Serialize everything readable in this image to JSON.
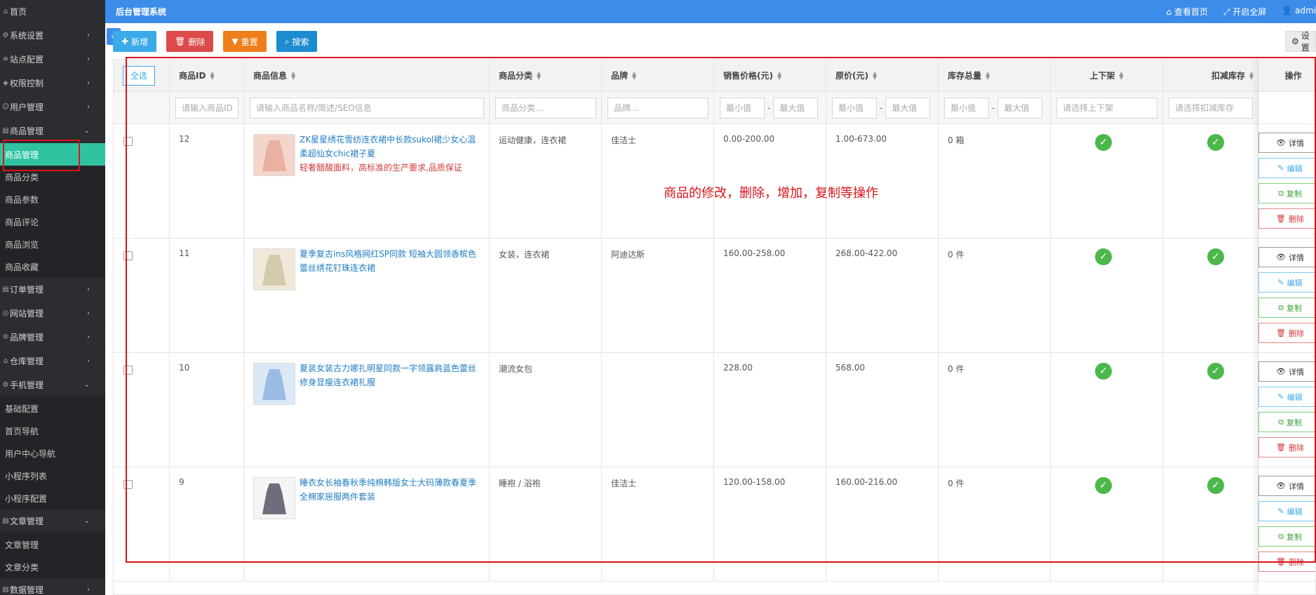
{
  "app": {
    "title": "后台管理系统"
  },
  "topbar": {
    "home": "⌂ 查看首页",
    "fullscreen": "⤢ 开启全屏",
    "user": "👤 admi"
  },
  "sidebar": {
    "items": [
      {
        "label": "首页",
        "icon": "home-icon",
        "chev": ""
      },
      {
        "label": "系统设置",
        "icon": "gear-icon",
        "chev": "›"
      },
      {
        "label": "站点配置",
        "icon": "sliders-icon",
        "chev": "›"
      },
      {
        "label": "权限控制",
        "icon": "shield-icon",
        "chev": "›"
      },
      {
        "label": "用户管理",
        "icon": "user-icon",
        "chev": "›"
      },
      {
        "label": "商品管理",
        "icon": "goods-icon",
        "chev": "⌄"
      }
    ],
    "goods_sub": [
      "商品管理",
      "商品分类",
      "商品参数",
      "商品评论",
      "商品浏览",
      "商品收藏"
    ],
    "items2": [
      {
        "label": "订单管理",
        "icon": "order-icon",
        "chev": "›"
      },
      {
        "label": "网站管理",
        "icon": "web-icon",
        "chev": "›"
      },
      {
        "label": "品牌管理",
        "icon": "brand-icon",
        "chev": "›"
      },
      {
        "label": "仓库管理",
        "icon": "warehouse-icon",
        "chev": "›"
      },
      {
        "label": "手机管理",
        "icon": "mobile-icon",
        "chev": "⌄"
      }
    ],
    "mobile_sub": [
      "基础配置",
      "首页导航",
      "用户中心导航",
      "小程序列表",
      "小程序配置"
    ],
    "items3": [
      {
        "label": "文章管理",
        "icon": "article-icon",
        "chev": "⌄"
      }
    ],
    "article_sub": [
      "文章管理",
      "文章分类"
    ],
    "items4": [
      {
        "label": "数据管理",
        "icon": "data-icon",
        "chev": "›"
      }
    ]
  },
  "toolbar": {
    "add": "新增",
    "delete": "删除",
    "reset": "重置",
    "search": "搜索",
    "settings": "设置"
  },
  "table": {
    "select_all": "全选",
    "headers": {
      "id": "商品ID",
      "info": "商品信息",
      "category": "商品分类",
      "brand": "品牌",
      "sale_price": "销售价格(元)",
      "orig_price": "原价(元)",
      "stock": "库存总量",
      "shelf": "上下架",
      "deduct": "扣减库存",
      "ops": "操作"
    },
    "filters": {
      "id": "请输入商品ID",
      "info": "请输入商品名称/简述/SEO信息",
      "category": "商品分类...",
      "brand": "品牌...",
      "min": "最小值",
      "max": "最大值",
      "shelf": "请选择上下架",
      "deduct": "请选择扣减库存"
    },
    "rows": [
      {
        "id": "12",
        "title": "ZK星星绣花雪纺连衣裙中长款sukol裙少女心温柔超仙女chic裙子夏",
        "subtitle": "轻奢醋酸面料，高标准的生产要求,品质保证",
        "category": "运动健康，连衣裙",
        "brand": "佳洁士",
        "sale": "0.00-200.00",
        "orig": "1.00-673.00",
        "stock": "0 箱",
        "thumb": "pink"
      },
      {
        "id": "11",
        "title": "夏季复古ins风格网红SP同款 短袖大圆领香槟色蕾丝绣花钉珠连衣裙",
        "subtitle": "",
        "category": "女装，连衣裙",
        "brand": "阿迪达斯",
        "sale": "160.00-258.00",
        "orig": "268.00-422.00",
        "stock": "0 件",
        "thumb": "beige"
      },
      {
        "id": "10",
        "title": "夏装女装古力娜扎明星同款一字领露肩蓝色蕾丝修身显瘦连衣裙礼服",
        "subtitle": "",
        "category": "潮流女包",
        "brand": "",
        "sale": "228.00",
        "orig": "568.00",
        "stock": "0 件",
        "thumb": "blue"
      },
      {
        "id": "9",
        "title": "睡衣女长袖春秋季纯棉韩版女士大码薄款春夏季全棉家居服两件套装",
        "subtitle": "",
        "category": "睡袍 / 浴袍",
        "brand": "佳洁士",
        "sale": "120.00-158.00",
        "orig": "160.00-216.00",
        "stock": "0 件",
        "thumb": "white"
      }
    ],
    "ops": {
      "detail": "详情",
      "edit": "编辑",
      "copy": "复制",
      "remove": "删除"
    }
  },
  "annotation": {
    "text": "商品的修改，删除，增加，复制等操作"
  },
  "colors": {
    "topbar": "#3c8dea",
    "active": "#2fc3a2",
    "annotation": "#d9131a"
  }
}
